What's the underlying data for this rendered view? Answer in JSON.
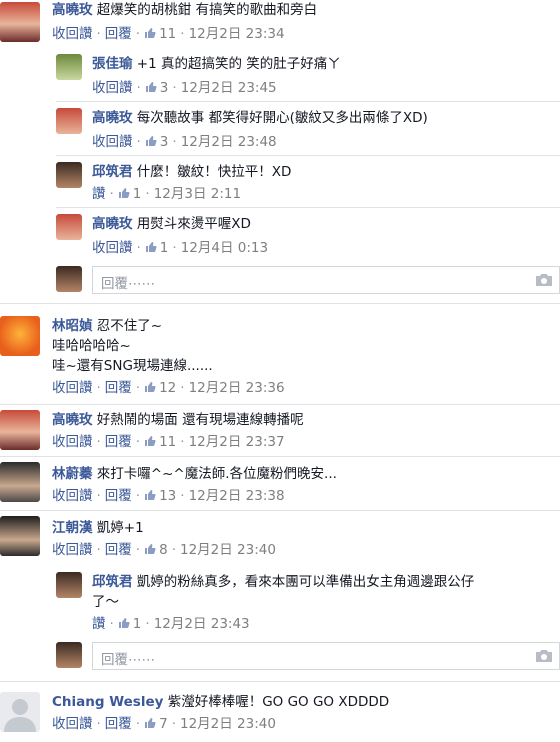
{
  "actions": {
    "reply": "收回讚",
    "reply2": "回覆",
    "like": "讚"
  },
  "placeholder": "回覆⋯⋯",
  "comments": [
    {
      "name": "高曉玫",
      "text": "超爆笑的胡桃鉗 有搞笑的歌曲和旁白",
      "likes": "11",
      "time": "12月2日 23:34"
    },
    {
      "name": "張佳瑜",
      "text": "+1 真的超搞笑的 笑的肚子好痛ㄚ",
      "likes": "3",
      "time": "12月2日 23:45"
    },
    {
      "name": "高曉玫",
      "text": "每次聽故事 都笑得好開心(皺紋又多出兩條了XD)",
      "likes": "3",
      "time": "12月2日 23:48"
    },
    {
      "name": "邱筑君",
      "text": "什麼！皺紋！快拉平！XD",
      "likes": "1",
      "time": "12月3日 2:11"
    },
    {
      "name": "高曉玫",
      "text": "用熨斗來燙平喔XD",
      "likes": "1",
      "time": "12月4日 0:13"
    },
    {
      "name": "林昭媜",
      "text1": "忍不住了~",
      "text2": "哇哈哈哈哈~",
      "text3": "哇~還有SNG現場連線......",
      "likes": "12",
      "time": "12月2日 23:36"
    },
    {
      "name": "高曉玫",
      "text": "好熱鬧的場面 還有現場連線轉播呢",
      "likes": "11",
      "time": "12月2日 23:37"
    },
    {
      "name": "林蔚蓁",
      "text": "來打卡囉^~^魔法師.各位魔粉們晚安...",
      "likes": "13",
      "time": "12月2日 23:38"
    },
    {
      "name": "江朝漢",
      "text": "凱婷+1",
      "likes": "8",
      "time": "12月2日 23:40"
    },
    {
      "name": "邱筑君",
      "text1": "凱婷的粉絲真多，看來本團可以準備出女主角週邊跟公仔",
      "text2": "了～",
      "likes": "1",
      "time": "12月2日 23:43"
    },
    {
      "name": "Chiang Wesley",
      "text": "紫瀅好棒棒喔！GO GO GO XDDDD",
      "likes": "7",
      "time": "12月2日 23:40"
    }
  ],
  "colors": {
    "link": "#3b5998",
    "meta": "#7f7f7f",
    "border": "#e1e2e3"
  }
}
